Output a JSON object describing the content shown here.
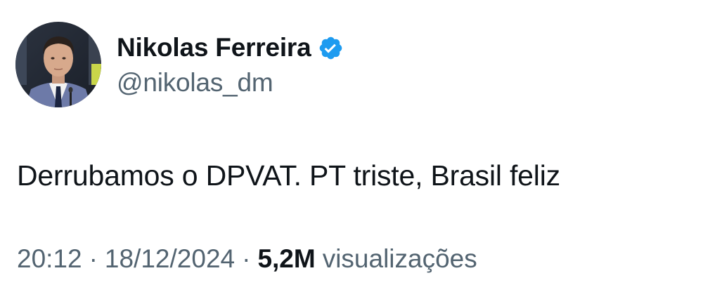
{
  "author": {
    "name": "Nikolas Ferreira",
    "handle": "@nikolas_dm",
    "verified": true,
    "avatar_icon": "profile-photo",
    "verified_icon": "verified-badge-icon"
  },
  "tweet": {
    "text": "Derrubamos o DPVAT. PT triste, Brasil feliz"
  },
  "meta": {
    "time": "20:12",
    "separator": "·",
    "date": "18/12/2024",
    "views_count": "5,2M",
    "views_label": "visualizações"
  },
  "colors": {
    "text_primary": "#0f1419",
    "text_secondary": "#536471",
    "verified_blue": "#1d9bf0",
    "background": "#ffffff"
  }
}
